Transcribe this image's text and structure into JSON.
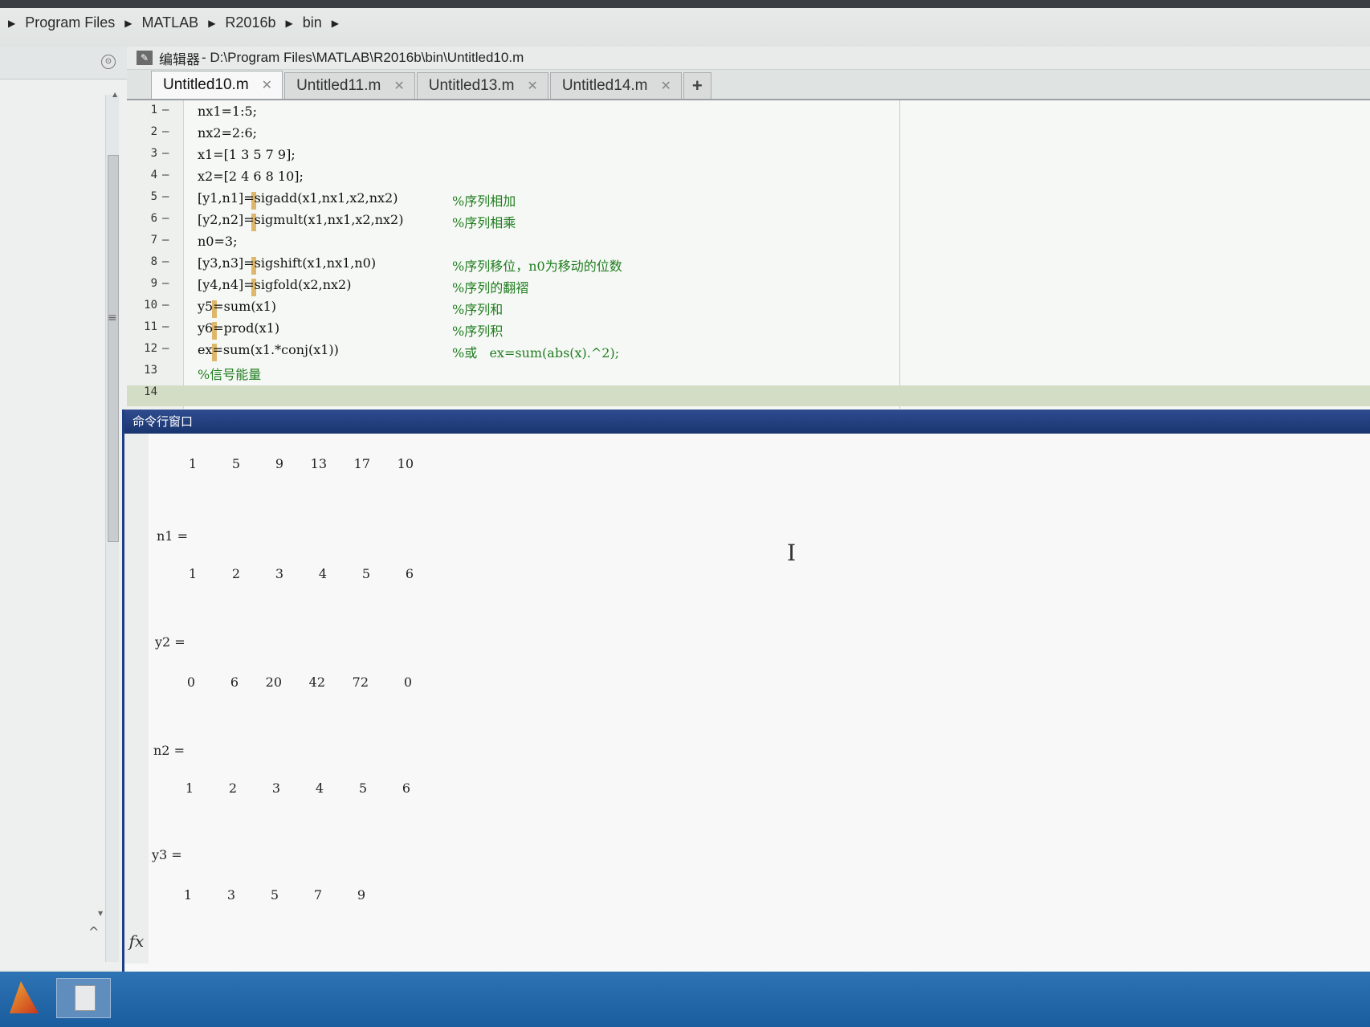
{
  "breadcrumb": [
    "Program Files",
    "MATLAB",
    "R2016b",
    "bin"
  ],
  "editor": {
    "title_prefix": "编辑器",
    "title_path": " - D:\\Program Files\\MATLAB\\R2016b\\bin\\Untitled10.m",
    "tabs": [
      {
        "label": "Untitled10.m",
        "close": "✕"
      },
      {
        "label": "Untitled11.m",
        "close": "✕"
      },
      {
        "label": "Untitled13.m",
        "close": "✕"
      },
      {
        "label": "Untitled14.m",
        "close": "✕"
      }
    ],
    "add_tab": "+",
    "lines": [
      {
        "n": "1",
        "dash": "–",
        "code": "nx1=1:5;",
        "comment": ""
      },
      {
        "n": "2",
        "dash": "–",
        "code": "nx2=2:6;",
        "comment": ""
      },
      {
        "n": "3",
        "dash": "–",
        "code": "x1=[1 3 5 7 9];",
        "comment": ""
      },
      {
        "n": "4",
        "dash": "–",
        "code": "x2=[2 4 6 8 10];",
        "comment": ""
      },
      {
        "n": "5",
        "dash": "–",
        "code": "[y1,n1]=sigadd(x1,nx1,x2,nx2)",
        "comment": "%序列相加"
      },
      {
        "n": "6",
        "dash": "–",
        "code": "[y2,n2]=sigmult(x1,nx1,x2,nx2)",
        "comment": "%序列相乘"
      },
      {
        "n": "7",
        "dash": "–",
        "code": "n0=3;",
        "comment": ""
      },
      {
        "n": "8",
        "dash": "–",
        "code": "[y3,n3]=sigshift(x1,nx1,n0)",
        "comment": "%序列移位，n0为移动的位数"
      },
      {
        "n": "9",
        "dash": "–",
        "code": "[y4,n4]=sigfold(x2,nx2)",
        "comment": "%序列的翻褶"
      },
      {
        "n": "10",
        "dash": "–",
        "code": "y5=sum(x1)",
        "comment": "%序列和"
      },
      {
        "n": "11",
        "dash": "–",
        "code": "y6=prod(x1)",
        "comment": "%序列积"
      },
      {
        "n": "12",
        "dash": "–",
        "code": "ex=sum(x1.*conj(x1))",
        "comment": "%或   ex=sum(abs(x).^2);"
      },
      {
        "n": "13",
        "dash": "",
        "code": "",
        "comment": "%信号能量"
      },
      {
        "n": "14",
        "dash": "",
        "code": "",
        "comment": ""
      }
    ]
  },
  "command_window": {
    "title": "命令行窗口",
    "blocks": [
      {
        "var": "",
        "values": [
          "1",
          "5",
          "9",
          "13",
          "17",
          "10"
        ]
      },
      {
        "var": "n1 =",
        "values": [
          "1",
          "2",
          "3",
          "4",
          "5",
          "6"
        ]
      },
      {
        "var": "y2 =",
        "values": [
          "0",
          "6",
          "20",
          "42",
          "72",
          "0"
        ]
      },
      {
        "var": "n2 =",
        "values": [
          "1",
          "2",
          "3",
          "4",
          "5",
          "6"
        ]
      },
      {
        "var": "y3 =",
        "values": [
          "1",
          "3",
          "5",
          "7",
          "9"
        ]
      }
    ],
    "fx_label": "fx",
    "cursor": "I"
  }
}
